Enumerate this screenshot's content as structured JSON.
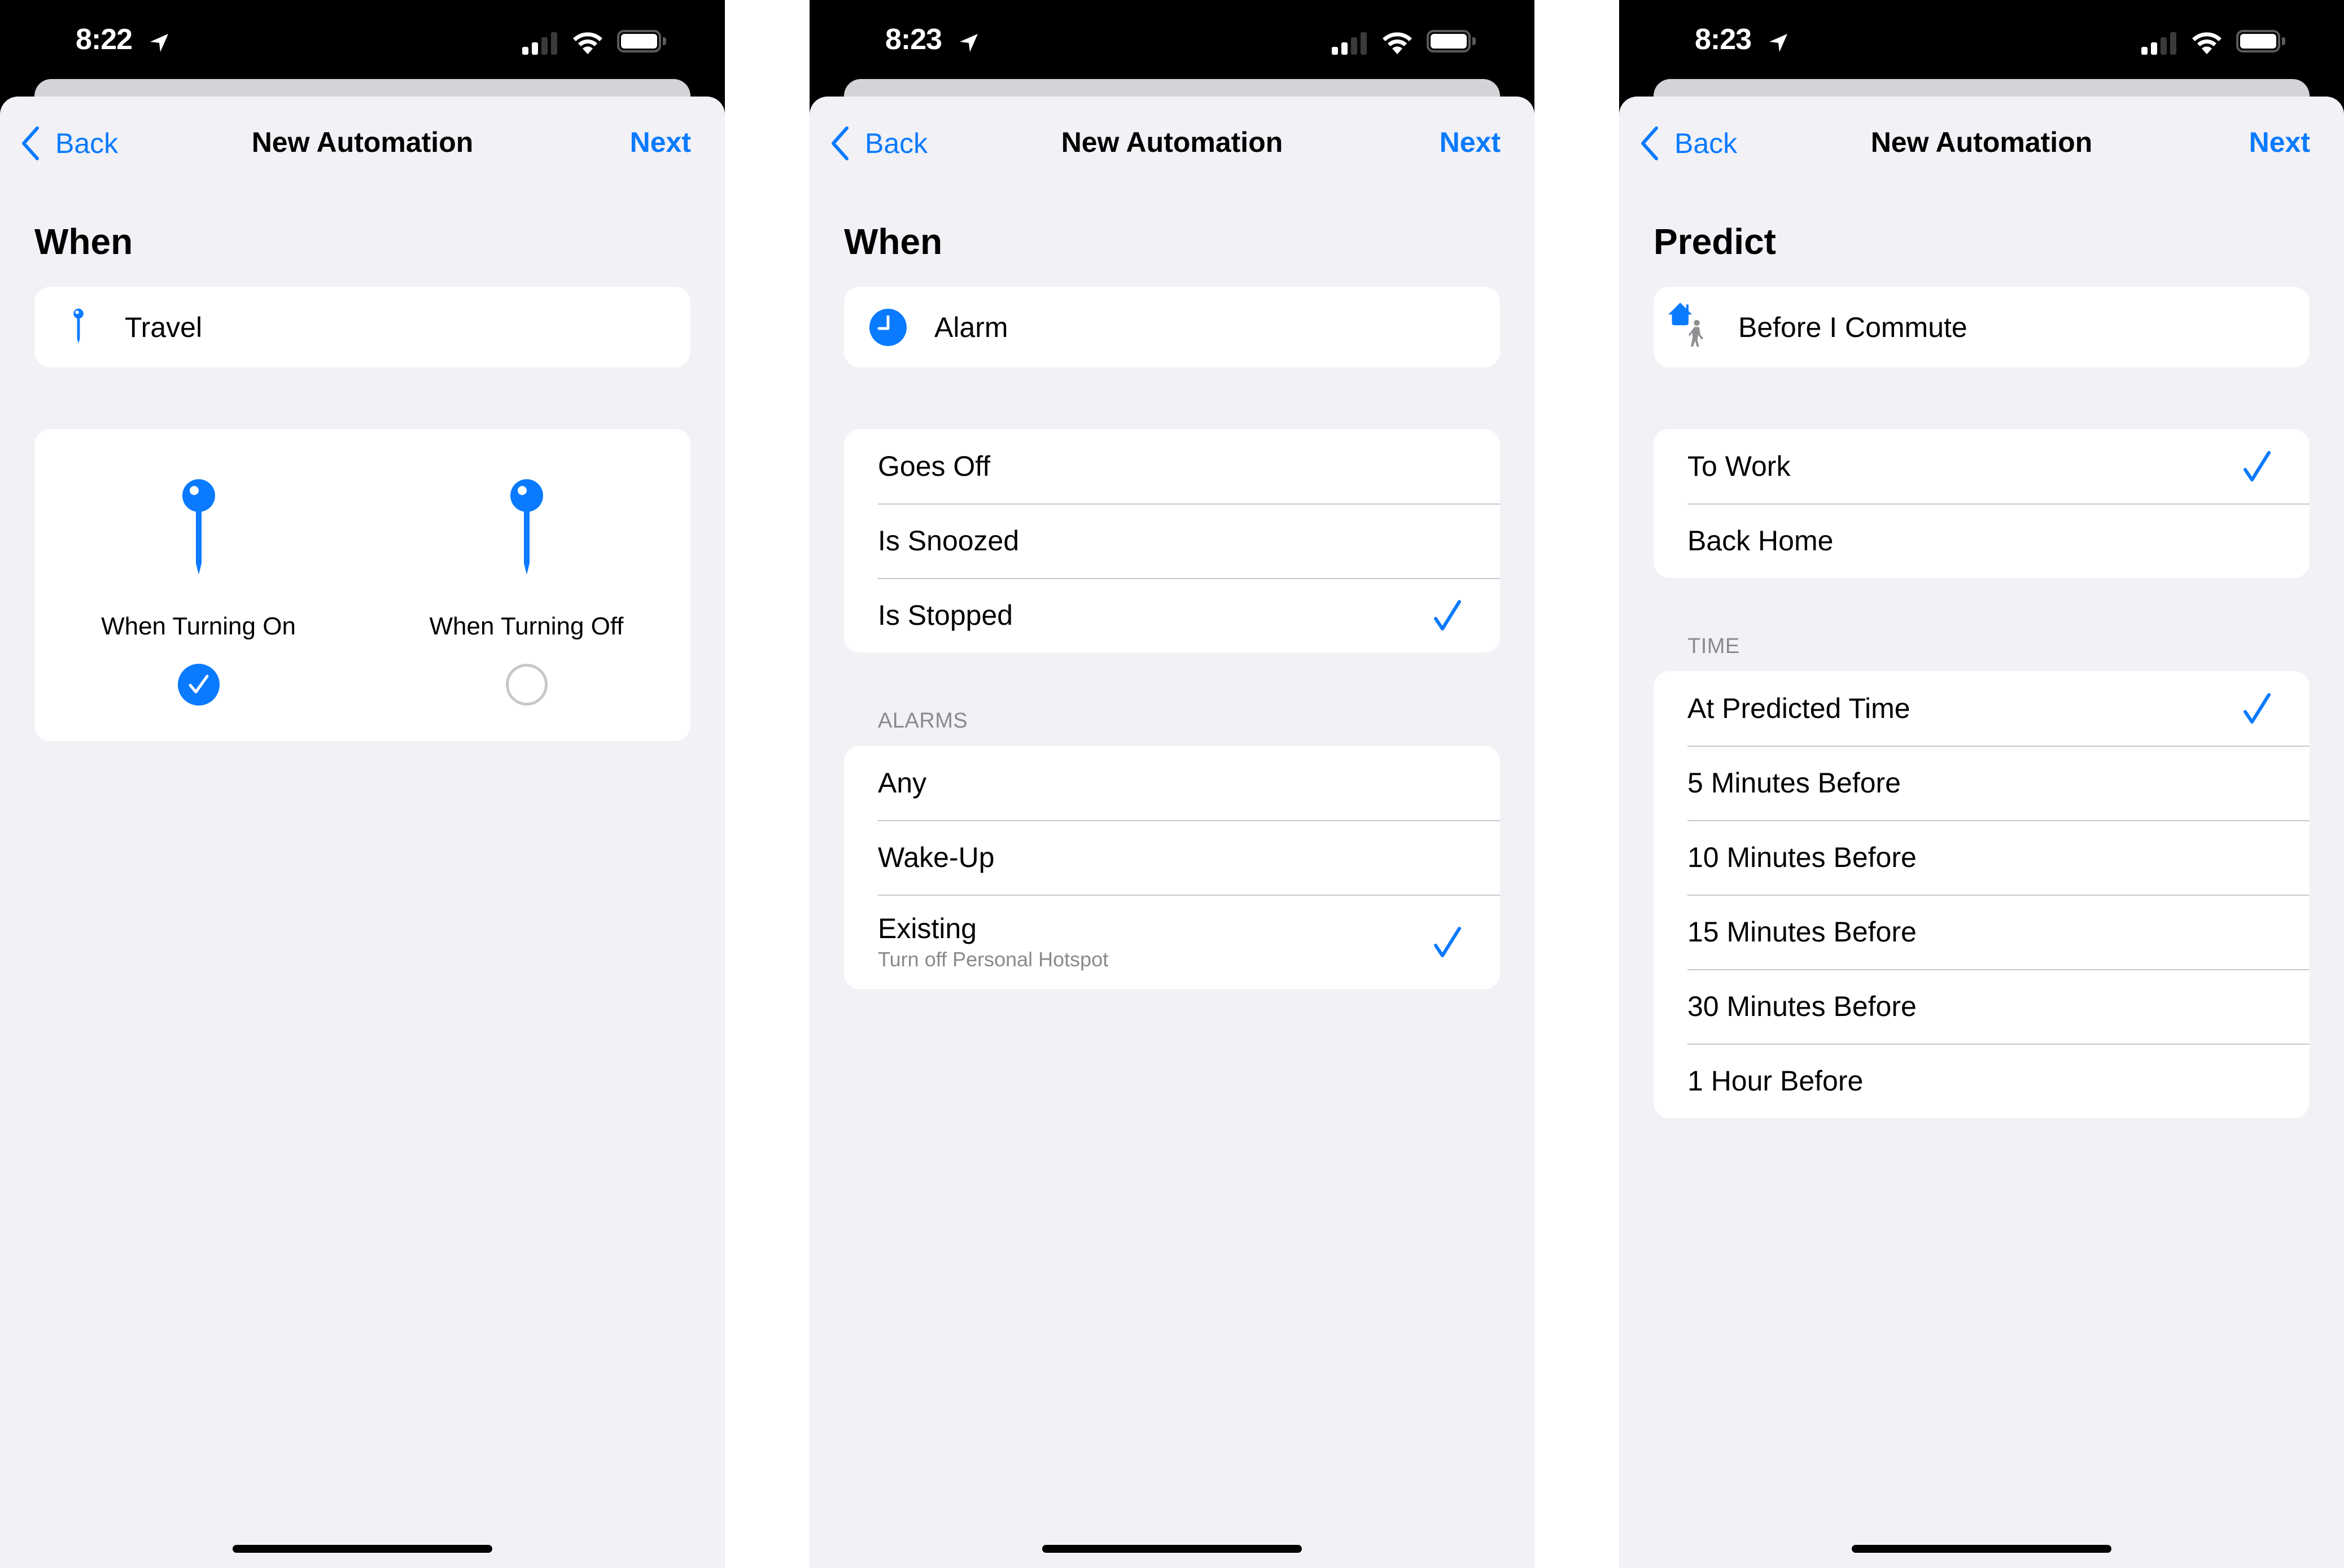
{
  "colors": {
    "accent": "#0a7aff",
    "background": "#f1f1f6",
    "card": "#ffffff",
    "secondary_text": "#8a8a8e",
    "separator": "#c8c8cc"
  },
  "screens": [
    {
      "status": {
        "time": "8:22",
        "signal_bars_active": 2,
        "signal_bars_total": 4,
        "battery": "full",
        "location_icon": "location-arrow-icon",
        "wifi_icon": "wifi-icon"
      },
      "nav": {
        "back_label": "Back",
        "title": "New Automation",
        "next_label": "Next"
      },
      "section_title": "When",
      "trigger": {
        "icon": "pin-icon",
        "label": "Travel"
      },
      "toggle_options": [
        {
          "label": "When Turning On",
          "selected": true
        },
        {
          "label": "When Turning Off",
          "selected": false
        }
      ]
    },
    {
      "status": {
        "time": "8:23",
        "signal_bars_active": 2,
        "signal_bars_total": 4,
        "battery": "full",
        "location_icon": "location-arrow-icon",
        "wifi_icon": "wifi-icon"
      },
      "nav": {
        "back_label": "Back",
        "title": "New Automation",
        "next_label": "Next"
      },
      "section_title": "When",
      "trigger": {
        "icon": "alarm-clock-icon",
        "label": "Alarm"
      },
      "events": [
        {
          "label": "Goes Off",
          "selected": false
        },
        {
          "label": "Is Snoozed",
          "selected": false
        },
        {
          "label": "Is Stopped",
          "selected": true
        }
      ],
      "alarms_header": "ALARMS",
      "alarms": [
        {
          "label": "Any",
          "selected": false
        },
        {
          "label": "Wake-Up",
          "selected": false
        },
        {
          "label": "Existing",
          "subtitle": "Turn off Personal Hotspot",
          "selected": true
        }
      ]
    },
    {
      "status": {
        "time": "8:23",
        "signal_bars_active": 2,
        "signal_bars_total": 4,
        "battery": "full",
        "location_icon": "location-arrow-icon",
        "wifi_icon": "wifi-icon"
      },
      "nav": {
        "back_label": "Back",
        "title": "New Automation",
        "next_label": "Next"
      },
      "section_title": "Predict",
      "trigger": {
        "icon": "home-commute-icon",
        "label": "Before I Commute"
      },
      "directions": [
        {
          "label": "To Work",
          "selected": true
        },
        {
          "label": "Back Home",
          "selected": false
        }
      ],
      "time_header": "TIME",
      "time_options": [
        {
          "label": "At Predicted Time",
          "selected": true
        },
        {
          "label": "5 Minutes Before",
          "selected": false
        },
        {
          "label": "10 Minutes Before",
          "selected": false
        },
        {
          "label": "15 Minutes Before",
          "selected": false
        },
        {
          "label": "30 Minutes Before",
          "selected": false
        },
        {
          "label": "1 Hour Before",
          "selected": false
        }
      ]
    }
  ]
}
